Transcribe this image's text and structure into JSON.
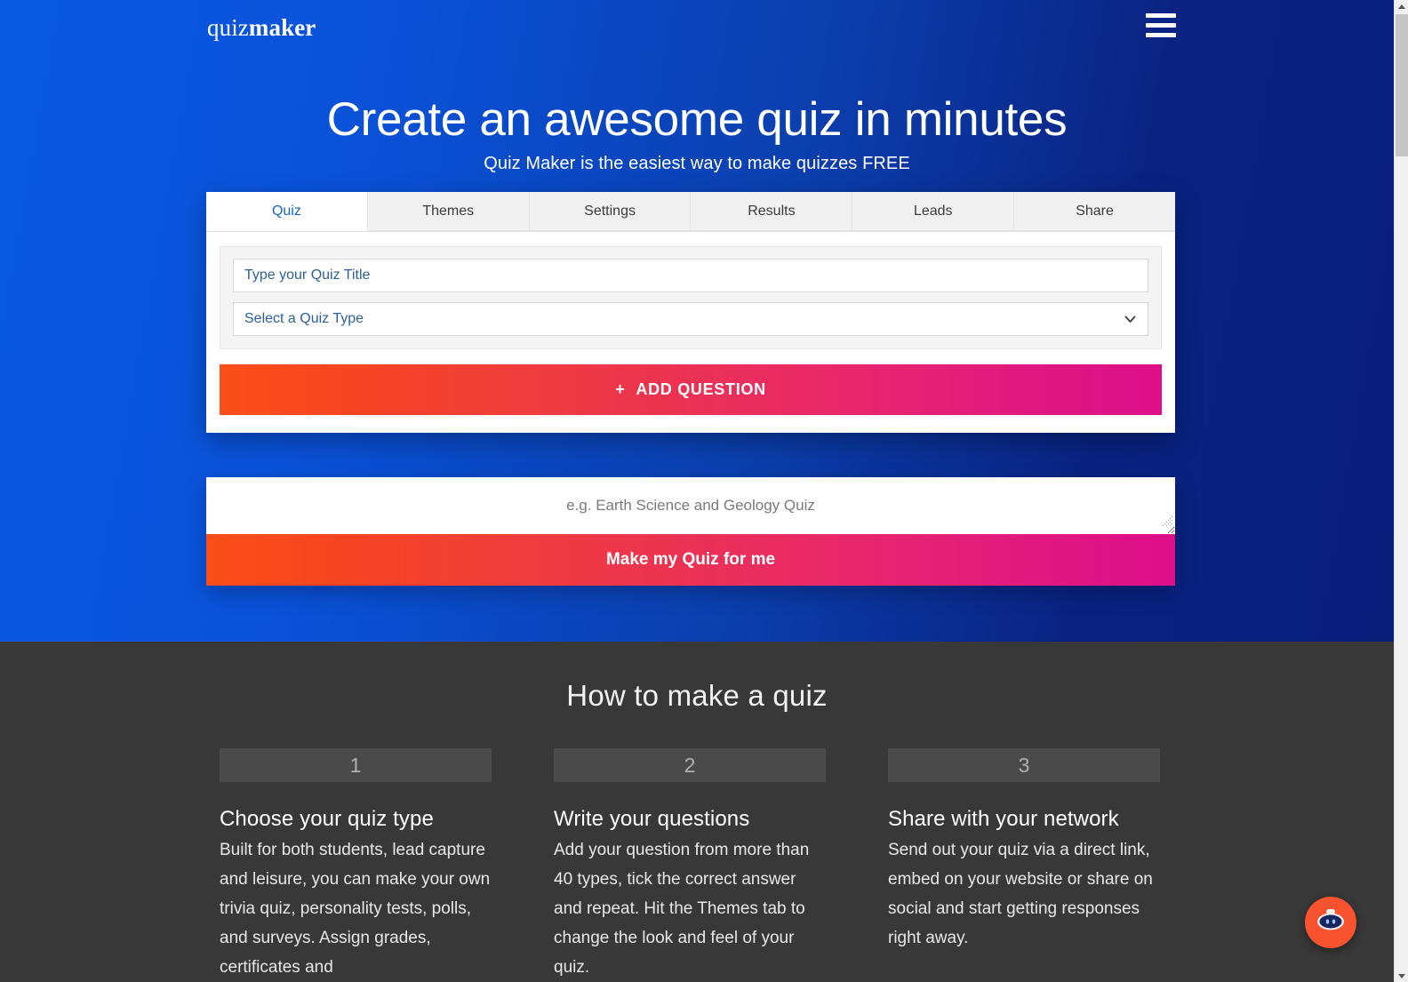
{
  "brand": {
    "logo_light": "quiz",
    "logo_bold": "maker",
    "menu_icon": "hamburger-icon",
    "accent_start": "#fb4f19",
    "accent_end": "#dd0f8a",
    "hero_blue_left": "#0a5ae4",
    "hero_blue_right": "#0a1e7c",
    "dark_section": "#383838"
  },
  "hero": {
    "headline": "Create an awesome quiz in minutes",
    "subheadline": "Quiz Maker is the easiest way to make quizzes FREE"
  },
  "card": {
    "tabs": [
      {
        "label": "Quiz",
        "active": true
      },
      {
        "label": "Themes",
        "active": false
      },
      {
        "label": "Settings",
        "active": false
      },
      {
        "label": "Results",
        "active": false
      },
      {
        "label": "Leads",
        "active": false
      },
      {
        "label": "Share",
        "active": false
      }
    ],
    "title_input": {
      "value": "",
      "placeholder": "Type your Quiz Title"
    },
    "quiz_type_select": {
      "selected": "Select a Quiz Type",
      "chevron_icon": "chevron-down-icon"
    },
    "add_question_button": {
      "plus": "+",
      "label": "ADD QUESTION"
    }
  },
  "ai_block": {
    "prompt": {
      "value": "",
      "placeholder": "e.g. Earth Science and Geology Quiz"
    },
    "make_button_label": "Make my Quiz for me"
  },
  "howto": {
    "title": "How to make a quiz",
    "steps": [
      {
        "number": "1",
        "title": "Choose your quiz type",
        "text": "Built for both students, lead capture and leisure, you can make your own trivia quiz, personality tests, polls, and surveys. Assign grades, certificates and"
      },
      {
        "number": "2",
        "title": "Write your questions",
        "text": "Add your question from more than 40 types, tick the correct answer and repeat. Hit the Themes tab to change the look and feel of your quiz."
      },
      {
        "number": "3",
        "title": "Share with your network",
        "text": "Send out your quiz via a direct link, embed on your website or share on social and start getting responses right away."
      }
    ]
  },
  "chat_widget": {
    "icon": "robot-chat-icon",
    "color": "#f8522e"
  },
  "scrollbar": {
    "up_icon": "scroll-up-arrow-icon",
    "down_icon": "scroll-down-arrow-icon"
  }
}
